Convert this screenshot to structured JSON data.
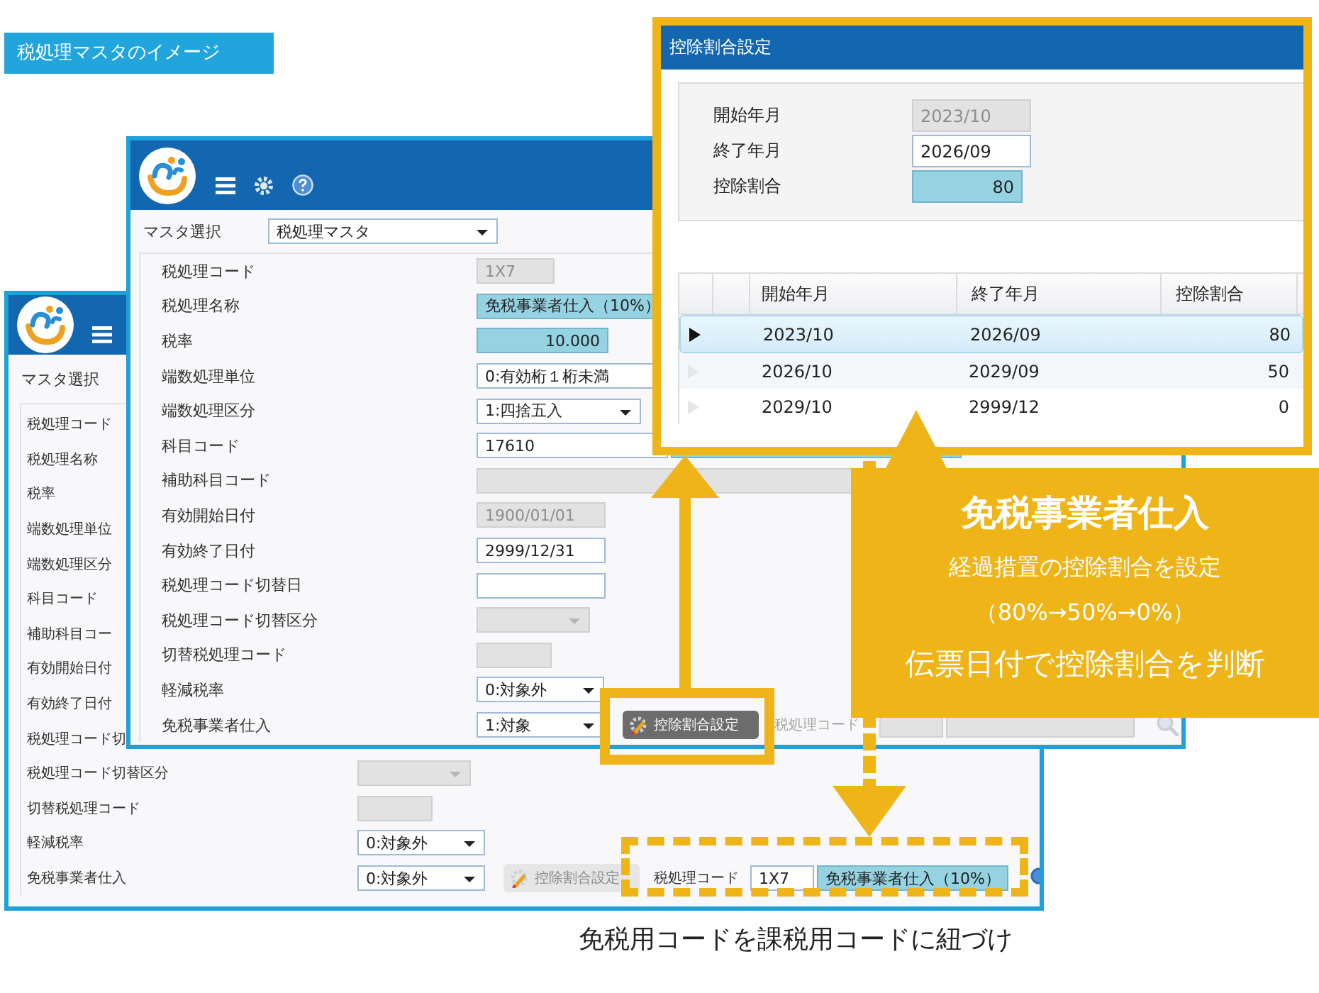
{
  "badge": "税処理マスタのイメージ",
  "back_window": {
    "master_label": "マスタ選択",
    "rows": [
      {
        "label": "税処理コード"
      },
      {
        "label": "税処理名称"
      },
      {
        "label": "税率"
      },
      {
        "label": "端数処理単位"
      },
      {
        "label": "端数処理区分"
      },
      {
        "label": "科目コード"
      },
      {
        "label": "補助科目コー"
      },
      {
        "label": "有効開始日付"
      },
      {
        "label": "有効終了日付"
      },
      {
        "label": "税処理コード切"
      },
      {
        "label": "税処理コード切替区分",
        "control": {
          "kind": "select",
          "disabled": true,
          "highlighted": false
        }
      },
      {
        "label": "切替税処理コード",
        "control": {
          "kind": "text",
          "disabled": true,
          "highlighted": false
        }
      },
      {
        "label": "軽減税率",
        "control": {
          "kind": "select",
          "value": "0:対象外",
          "disabled": false,
          "highlighted": false
        }
      },
      {
        "label": "免税事業者仕入",
        "control": {
          "kind": "select",
          "value": "0:対象外",
          "disabled": false,
          "highlighted": false
        },
        "extras": [
          {
            "kind": "button",
            "label": "控除割合設定",
            "disabled": true
          },
          {
            "kind": "label",
            "label": "税処理コード",
            "disabled": false
          },
          {
            "kind": "text",
            "value": "1X7",
            "disabled": false,
            "highlighted": false
          },
          {
            "kind": "text",
            "value": "免税事業者仕入（10%）",
            "disabled": false,
            "highlighted": true
          },
          {
            "kind": "search",
            "disabled": false
          }
        ]
      }
    ]
  },
  "front_window": {
    "master_label": "マスタ選択",
    "master_value": "税処理マスタ",
    "rows": [
      {
        "label": "税処理コード",
        "control": {
          "kind": "text",
          "value": "1X7",
          "disabled": true,
          "highlighted": false
        }
      },
      {
        "label": "税処理名称",
        "control": {
          "kind": "text",
          "value": "免税事業者仕入（10%）",
          "disabled": false,
          "highlighted": true
        }
      },
      {
        "label": "税率",
        "control": {
          "kind": "number",
          "value": "10.000",
          "disabled": false,
          "highlighted": true
        }
      },
      {
        "label": "端数処理単位",
        "control": {
          "kind": "text",
          "value": "0:有効桁１桁未満",
          "disabled": false,
          "highlighted": false
        }
      },
      {
        "label": "端数処理区分",
        "control": {
          "kind": "select",
          "value": "1:四捨五入",
          "disabled": false,
          "highlighted": false
        }
      },
      {
        "label": "科目コード",
        "control": {
          "kind": "text",
          "value": "17610",
          "disabled": false,
          "highlighted": false
        },
        "extras": [
          {
            "kind": "text",
            "disabled": false,
            "highlighted": true
          }
        ]
      },
      {
        "label": "補助科目コード",
        "control": {
          "kind": "text",
          "disabled": true,
          "highlighted": false
        }
      },
      {
        "label": "有効開始日付",
        "control": {
          "kind": "text",
          "value": "1900/01/01",
          "disabled": true,
          "highlighted": false
        }
      },
      {
        "label": "有効終了日付",
        "control": {
          "kind": "text",
          "value": "2999/12/31",
          "disabled": false,
          "highlighted": false
        }
      },
      {
        "label": "税処理コード切替日",
        "control": {
          "kind": "text",
          "disabled": false,
          "highlighted": false
        }
      },
      {
        "label": "税処理コード切替区分",
        "control": {
          "kind": "select",
          "disabled": true,
          "highlighted": false
        }
      },
      {
        "label": "切替税処理コード",
        "control": {
          "kind": "text",
          "disabled": true,
          "highlighted": false
        }
      },
      {
        "label": "軽減税率",
        "control": {
          "kind": "select",
          "value": "0:対象外",
          "disabled": false,
          "highlighted": false
        }
      },
      {
        "label": "免税事業者仕入",
        "control": {
          "kind": "select",
          "value": "1:対象",
          "disabled": false,
          "highlighted": false
        },
        "extras": [
          {
            "kind": "button",
            "label": "控除割合設定",
            "disabled": false
          },
          {
            "kind": "label",
            "label": "税処理コード",
            "disabled": true
          },
          {
            "kind": "text",
            "disabled": true,
            "highlighted": false
          },
          {
            "kind": "text",
            "disabled": true,
            "highlighted": false
          },
          {
            "kind": "search",
            "disabled": true
          }
        ]
      }
    ]
  },
  "dialog": {
    "title": "控除割合設定",
    "form": [
      {
        "label": "開始年月",
        "value": "2023/10",
        "kind": "text",
        "disabled": true,
        "highlighted": false
      },
      {
        "label": "終了年月",
        "value": "2026/09",
        "kind": "text",
        "disabled": false,
        "highlighted": false
      },
      {
        "label": "控除割合",
        "value": "80",
        "kind": "number",
        "disabled": false,
        "highlighted": true
      }
    ],
    "columns": [
      "開始年月",
      "終了年月",
      "控除割合"
    ],
    "rows": [
      {
        "selected": true,
        "cells": [
          "2023/10",
          "2026/09",
          "80"
        ]
      },
      {
        "selected": false,
        "cells": [
          "2026/10",
          "2029/09",
          "50"
        ]
      },
      {
        "selected": false,
        "cells": [
          "2029/10",
          "2999/12",
          "0"
        ]
      }
    ]
  },
  "callout": {
    "title": "免税事業者仕入",
    "lines": [
      "経過措置の控除割合を設定",
      "（80%→50%→0%）",
      "伝票日付で控除割合を判断"
    ]
  },
  "footer_caption": "免税用コードを課税用コードに紐づけ"
}
